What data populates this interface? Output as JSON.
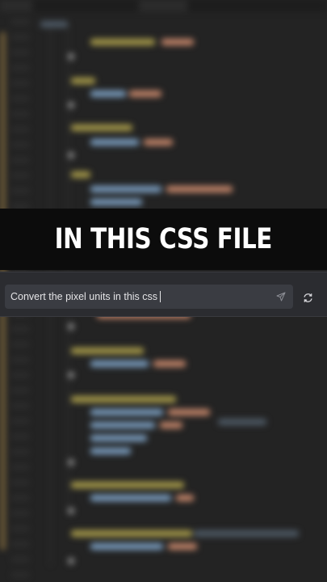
{
  "overlay": {
    "caption": "IN THIS CSS FILE"
  },
  "chat": {
    "input_value": "Convert the pixel units in this css",
    "send_icon": "send-icon",
    "refresh_icon": "refresh-icon"
  },
  "colors": {
    "editor_background": "#232323",
    "banner_background": "#0c0c0c",
    "chat_panel": "#2b2c30",
    "chat_input": "#3a3c42",
    "selector_token": "#a89b4a",
    "property_token": "#7b9ec0",
    "value_token": "#c5866a"
  }
}
